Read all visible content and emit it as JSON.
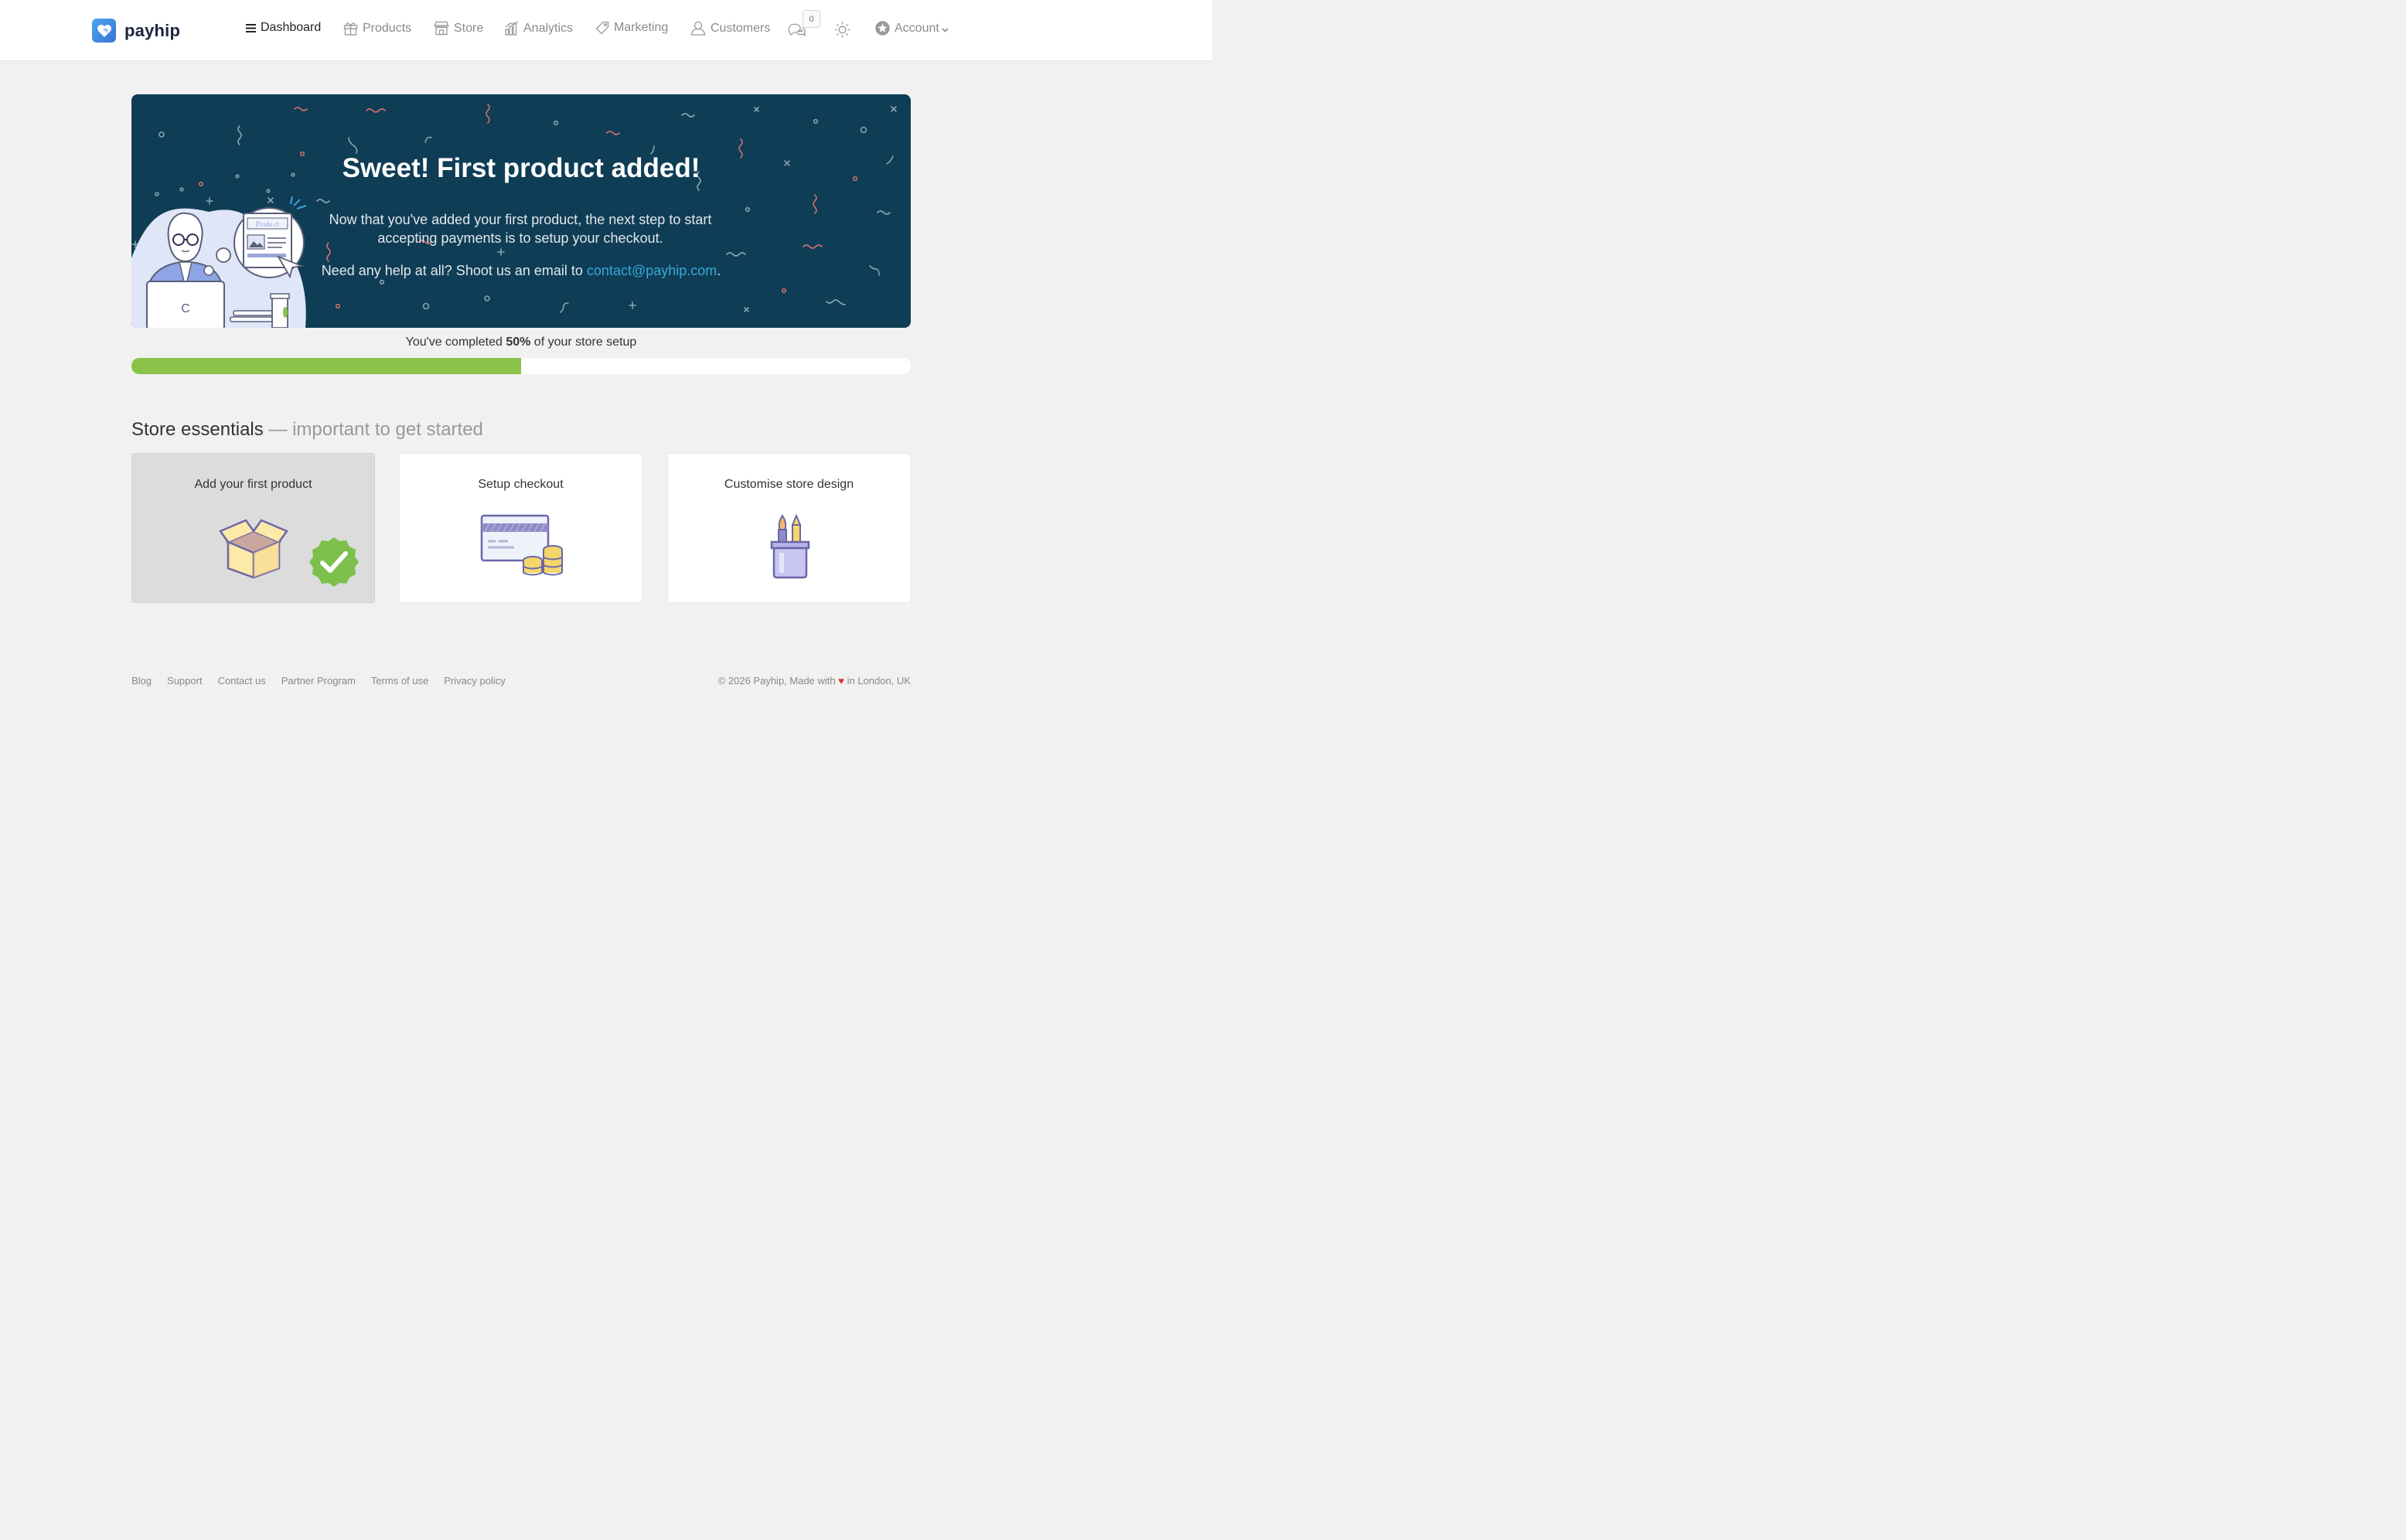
{
  "brand": {
    "name": "payhip"
  },
  "nav": {
    "items": [
      {
        "label": "Dashboard",
        "icon": "hamburger-icon",
        "active": true
      },
      {
        "label": "Products",
        "icon": "gift-icon"
      },
      {
        "label": "Store",
        "icon": "store-icon"
      },
      {
        "label": "Analytics",
        "icon": "bar-chart-icon"
      },
      {
        "label": "Marketing",
        "icon": "tag-icon"
      },
      {
        "label": "Customers",
        "icon": "user-icon"
      }
    ],
    "messages_count": "0",
    "account_label": "Account"
  },
  "banner": {
    "title": "Sweet! First product added!",
    "text1": "Now that you've added your first product, the next step to start accepting payments is to setup your checkout.",
    "text2_prefix": "Need any help at all? Shoot us an email to ",
    "email": "contact@payhip.com",
    "text2_suffix": ".",
    "illustration_label": "Produ ct",
    "background": "#0f3d55"
  },
  "progress": {
    "label_prefix": "You've completed ",
    "percent_label": "50%",
    "label_suffix": " of your store setup",
    "value": 0.5,
    "color": "#8bc34a"
  },
  "essentials": {
    "title": "Store essentials",
    "subtitle": " — important to get started",
    "cards": [
      {
        "title": "Add your first product",
        "completed": true,
        "icon": "box-icon"
      },
      {
        "title": "Setup checkout",
        "completed": false,
        "icon": "credit-card-coins-icon"
      },
      {
        "title": "Customise store design",
        "completed": false,
        "icon": "brush-pencil-cup-icon"
      }
    ]
  },
  "footer": {
    "links": [
      "Blog",
      "Support",
      "Contact us",
      "Partner Program",
      "Terms of use",
      "Privacy policy"
    ],
    "copyright_prefix": "© 2026 Payhip, Made with ",
    "heart": "♥",
    "copyright_suffix": " in London, UK"
  }
}
